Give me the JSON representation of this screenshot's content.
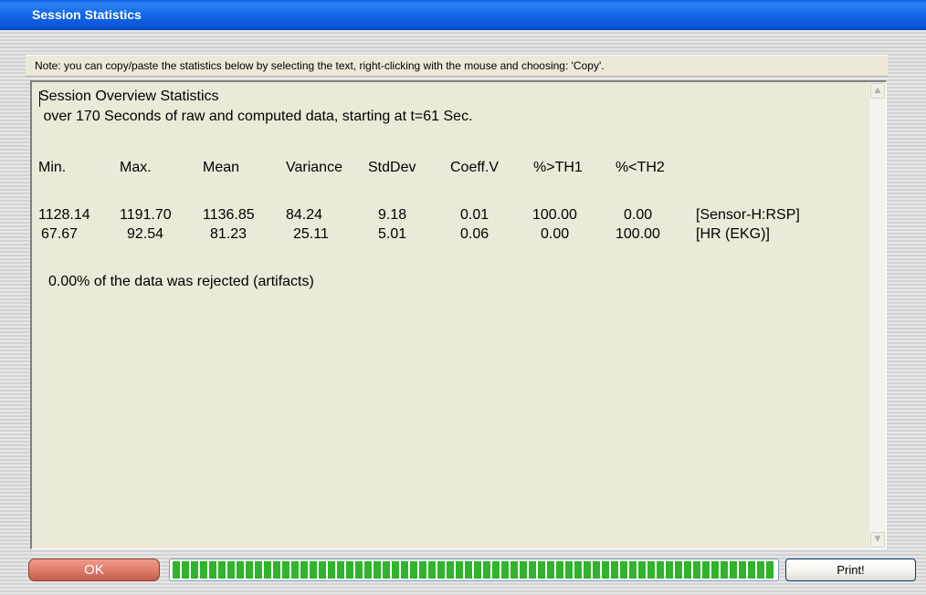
{
  "window": {
    "title": "Session Statistics"
  },
  "note": "Note: you can copy/paste the statistics below by selecting the text, right-clicking with the mouse and choosing: 'Copy'.",
  "stats": {
    "heading": "Session Overview Statistics",
    "subheading": " over 170 Seconds of raw and computed data, starting at t=61 Sec.",
    "columns": [
      "Min.",
      "Max.",
      "Mean",
      "Variance",
      "StdDev",
      "Coeff.V",
      "%>TH1",
      "%<TH2"
    ],
    "rows": [
      {
        "min": "1128.14",
        "max": "1191.70",
        "mean": "1136.85",
        "variance": "84.24",
        "stddev": "9.18",
        "coeffv": "0.01",
        "pct_gt_th1": "100.00",
        "pct_lt_th2": "0.00",
        "label": "[Sensor-H:RSP]"
      },
      {
        "min": "67.67",
        "max": "92.54",
        "mean": "81.23",
        "variance": "25.11",
        "stddev": "5.01",
        "coeffv": "0.06",
        "pct_gt_th1": "0.00",
        "pct_lt_th2": "100.00",
        "label": "[HR (EKG)]"
      }
    ],
    "rejected": "0.00% of the data was rejected (artifacts)"
  },
  "buttons": {
    "ok": "OK",
    "print": "Print!"
  },
  "progress": {
    "fraction": 1.0
  },
  "colors": {
    "titlebar": "#0b57d8",
    "dialog_bg": "#ece9d8",
    "ok_button": "#de7f6d",
    "progress_fill": "#2fb42b"
  },
  "icons": {
    "scroll_up": "scroll-up-arrow-icon",
    "scroll_down": "scroll-down-arrow-icon"
  }
}
